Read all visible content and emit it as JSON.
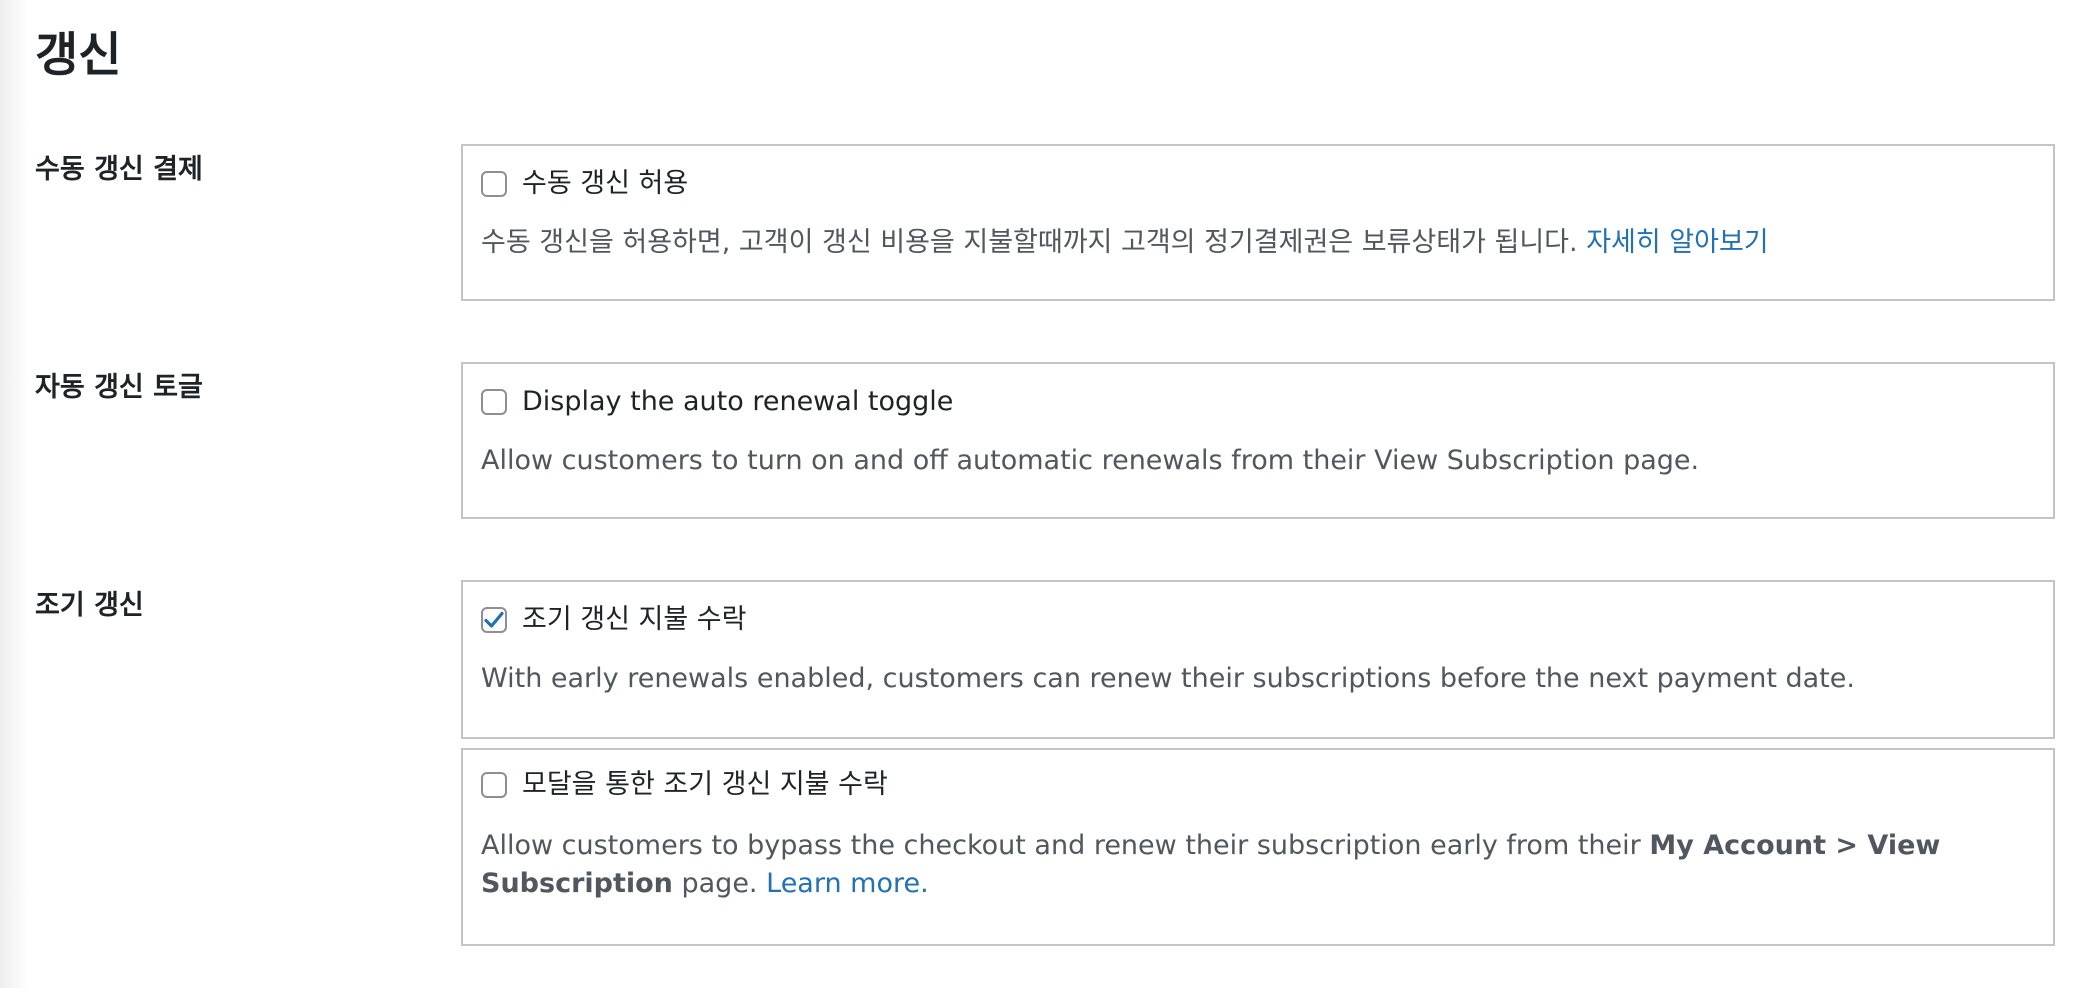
{
  "page": {
    "title": "갱신"
  },
  "manual_renewal": {
    "label": "수동 갱신 결제",
    "checkbox_label": "수동 갱신 허용",
    "checked": false,
    "description": "수동 갱신을 허용하면, 고객이 갱신 비용을 지불할때까지 고객의 정기결제권은 보류상태가 됩니다.",
    "link_text": "자세히 알아보기"
  },
  "auto_renewal_toggle": {
    "label": "자동 갱신 토글",
    "checkbox_label": "Display the auto renewal toggle",
    "checked": false,
    "description": "Allow customers to turn on and off automatic renewals from their View Subscription page."
  },
  "early_renewal": {
    "label": "조기 갱신",
    "accept": {
      "checkbox_label": "조기 갱신 지불 수락",
      "checked": true,
      "description": "With early renewals enabled, customers can renew their subscriptions before the next payment date."
    },
    "modal": {
      "checkbox_label": "모달을 통한 조기 갱신 지불 수락",
      "checked": false,
      "description_before": "Allow customers to bypass the checkout and renew their subscription early from their",
      "description_bold": "My Account > View Subscription",
      "description_after": "page.",
      "link_text": "Learn more."
    }
  },
  "colors": {
    "link": "#2271b1",
    "checkmark": "#2271b1",
    "border": "#c3c4c7",
    "description": "#50575e"
  }
}
